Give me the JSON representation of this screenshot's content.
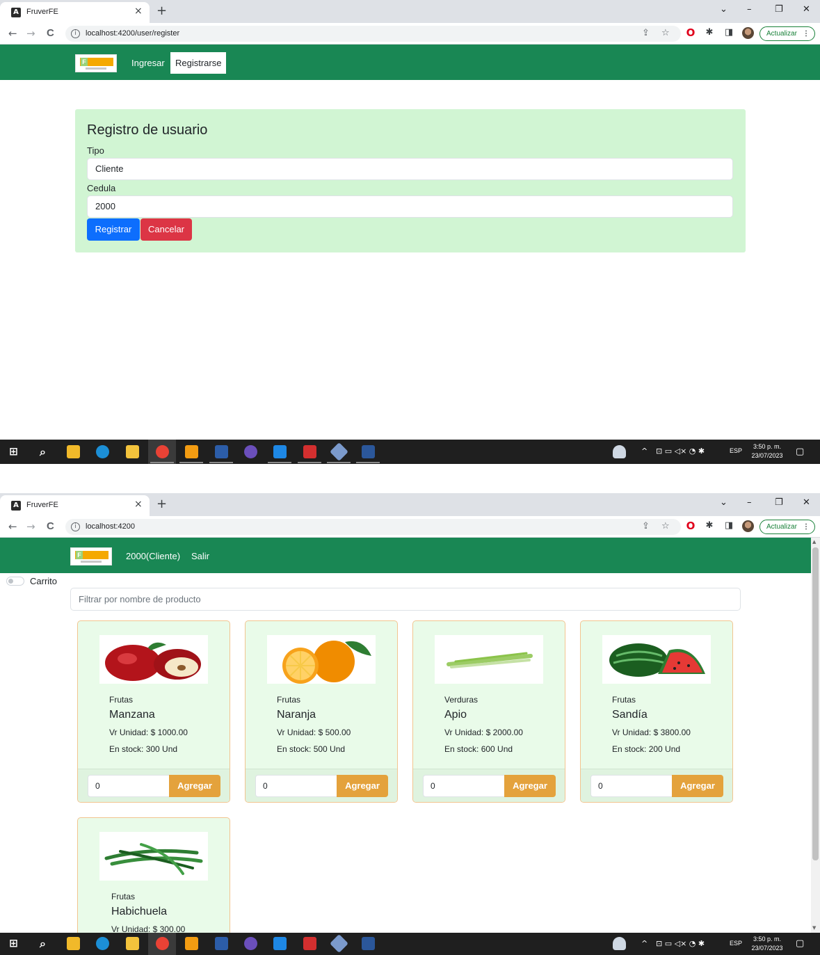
{
  "browser": {
    "tab_title": "FruverFE",
    "tab_close": "×",
    "tab_new": "+",
    "win_chevron": "⌄",
    "win_min": "–",
    "win_restore": "❐",
    "win_close": "✕",
    "back": "←",
    "forward": "→",
    "reload": "C",
    "info_glyph": "i",
    "share_glyph": "⇪",
    "star_glyph": "☆",
    "opera_glyph": "O",
    "puzzle_glyph": "✱",
    "sidepanel_glyph": "◨",
    "update_label": "Actualizar",
    "menu_dots": "⋮"
  },
  "register_page": {
    "url": "localhost:4200/user/register",
    "nav": {
      "login": "Ingresar",
      "register": "Registrarse"
    },
    "form": {
      "title": "Registro de usuario",
      "type_label": "Tipo",
      "type_value": "Cliente",
      "id_label": "Cedula",
      "id_value": "2000",
      "submit_label": "Registrar",
      "cancel_label": "Cancelar"
    }
  },
  "shop_page": {
    "url": "localhost:4200",
    "nav": {
      "user": "2000(Cliente)",
      "logout": "Salir"
    },
    "cart_label": "Carrito",
    "filter_placeholder": "Filtrar por nombre de producto",
    "products": [
      {
        "category": "Frutas",
        "name": "Manzana",
        "price": "Vr Unidad: $ 1000.00",
        "stock": "En stock: 300 Und",
        "qty": "0",
        "add_label": "Agregar"
      },
      {
        "category": "Frutas",
        "name": "Naranja",
        "price": "Vr Unidad: $ 500.00",
        "stock": "En stock: 500 Und",
        "qty": "0",
        "add_label": "Agregar"
      },
      {
        "category": "Verduras",
        "name": "Apio",
        "price": "Vr Unidad: $ 2000.00",
        "stock": "En stock: 600 Und",
        "qty": "0",
        "add_label": "Agregar"
      },
      {
        "category": "Frutas",
        "name": "Sandía",
        "price": "Vr Unidad: $ 3800.00",
        "stock": "En stock: 200 Und",
        "qty": "0",
        "add_label": "Agregar"
      },
      {
        "category": "Frutas",
        "name": "Habichuela",
        "price": "Vr Unidad: $ 300.00"
      }
    ]
  },
  "taskbar": {
    "start_glyph": "⊞",
    "search_glyph": "⌕",
    "tray_chevron": "^",
    "tray_glyphs": "⊡ ▭ ◁× ◔ ✱",
    "lang": "ESP",
    "time": "3:50 p. m.",
    "date": "23/07/2023",
    "notif_glyph": "▢"
  },
  "colors": {
    "navbar": "#198754",
    "card_bg": "#d1f5d3",
    "primary": "#0d6efd",
    "danger": "#dc3545",
    "add_button": "#e4a23c"
  }
}
